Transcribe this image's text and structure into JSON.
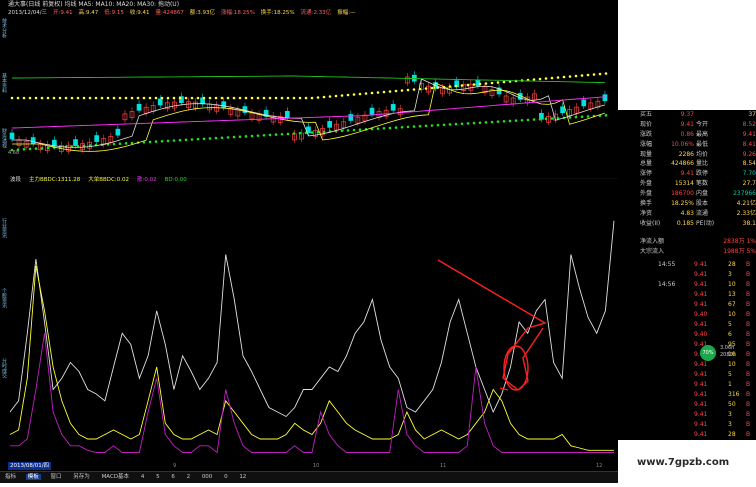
{
  "title_bar": "通大事(日线 前复权) 均线 MA5: MA10: MA20: MA30: 拖动(U)",
  "info_bar": [
    "2013/12/04/三",
    "开:9.41",
    "高:9.47",
    "低:9.15",
    "收:9.41",
    "量:424867",
    "额:3.93亿",
    "涨幅:18.25%",
    "换手:18.25%",
    "流通:2.33亿",
    "振幅:—"
  ],
  "indicator_header": [
    "波段",
    "主力BBDC:1311.28",
    "大单BBDC:0.02",
    "散:0.02",
    "BD:0.00"
  ],
  "chart_labels": {
    "bottom_price": "4.68",
    "date_box": "2013/08/01/四"
  },
  "x_axis_labels": [
    "9",
    "10",
    "11",
    "12"
  ],
  "bottom_tabs": [
    "指标",
    "模板",
    "窗口",
    "另存为",
    "MACD基本",
    "4",
    "5",
    "6",
    "2",
    "000",
    "0",
    "12"
  ],
  "stats_rows": [
    {
      "l1": "买五",
      "v1": "9.37",
      "l2": "",
      "v2": "37"
    },
    {
      "l1": "现价",
      "v1": "9.41",
      "l2": "今开",
      "v2": "8.52"
    },
    {
      "l1": "涨跌",
      "v1": "0.86",
      "l2": "最高",
      "v2": "9.41"
    },
    {
      "l1": "涨幅",
      "v1": "10.06%",
      "l2": "最低",
      "v2": "8.41"
    },
    {
      "l1": "现量",
      "v1": "2286",
      "l2": "均价",
      "v2": "9.26"
    },
    {
      "l1": "总量",
      "v1": "424866",
      "l2": "量比",
      "v2": "8.54"
    },
    {
      "l1": "涨停",
      "v1": "9.41",
      "l2": "跌停",
      "v2": "7.70"
    },
    {
      "l1": "外盘",
      "v1": "15314",
      "l2": "笔数",
      "v2": "27.7"
    },
    {
      "l1": "外盘",
      "v1": "186700",
      "l2": "内盘",
      "v2": "237966"
    },
    {
      "l1": "换手",
      "v1": "18.25%",
      "l2": "股本",
      "v2": "4.21亿"
    },
    {
      "l1": "净资",
      "v1": "4.83",
      "l2": "流通",
      "v2": "2.33亿"
    },
    {
      "l1": "收益(II)",
      "v1": "0.185",
      "l2": "PE(动)",
      "v2": "38.1"
    }
  ],
  "flow_rows": [
    {
      "label": "净流入额",
      "value": "2838万 1%"
    },
    {
      "label": "大宗流入",
      "value": "1988万 5%"
    }
  ],
  "tick_rows": [
    {
      "time": "14:55",
      "price": "9.41",
      "vol": "28",
      "dir": "B"
    },
    {
      "time": "",
      "price": "9.41",
      "vol": "3",
      "dir": "B"
    },
    {
      "time": "14:56",
      "price": "9.41",
      "vol": "10",
      "dir": "B"
    },
    {
      "time": "",
      "price": "9.41",
      "vol": "13",
      "dir": "B"
    },
    {
      "time": "",
      "price": "9.41",
      "vol": "67",
      "dir": "B"
    },
    {
      "time": "",
      "price": "9.40",
      "vol": "10",
      "dir": "B"
    },
    {
      "time": "",
      "price": "9.41",
      "vol": "5",
      "dir": "B"
    },
    {
      "time": "",
      "price": "9.40",
      "vol": "6",
      "dir": "B"
    },
    {
      "time": "",
      "price": "9.41",
      "vol": "95",
      "dir": "B"
    },
    {
      "time": "",
      "price": "9.41",
      "vol": "10",
      "dir": "B"
    },
    {
      "time": "",
      "price": "9.41",
      "vol": "10",
      "dir": "B"
    },
    {
      "time": "",
      "price": "9.41",
      "vol": "5",
      "dir": "B"
    },
    {
      "time": "",
      "price": "9.41",
      "vol": "1",
      "dir": "B"
    },
    {
      "time": "",
      "price": "9.41",
      "vol": "316",
      "dir": "B"
    },
    {
      "time": "",
      "price": "9.41",
      "vol": "50",
      "dir": "B"
    },
    {
      "time": "",
      "price": "9.41",
      "vol": "3",
      "dir": "B"
    },
    {
      "time": "",
      "price": "9.41",
      "vol": "3",
      "dir": "B"
    },
    {
      "time": "",
      "price": "9.41",
      "vol": "28",
      "dir": "B"
    }
  ],
  "gauge": {
    "label": "70%",
    "v1": "3.06h",
    "v2": "2080h"
  },
  "watermark": "www.7gpzb.com",
  "colors": {
    "bg": "#000000",
    "up": "#ff4444",
    "down": "#00e0e0",
    "yellow": "#ffff30",
    "magenta": "#ff30ff",
    "green": "#20e020",
    "white": "#e0e0e0",
    "purple": "#c020c0",
    "annotation": "#ff2020"
  },
  "chart_data": {
    "type": "line",
    "series": [
      {
        "values": [
          0.2,
          0.25,
          0.55,
          0.88,
          0.6,
          0.3,
          0.35,
          0.42,
          0.38,
          0.3,
          0.28,
          0.25,
          0.4,
          0.55,
          0.5,
          0.35,
          0.45,
          0.65,
          0.5,
          0.3,
          0.45,
          0.38,
          0.3,
          0.35,
          0.42,
          0.9,
          0.7,
          0.45,
          0.38,
          0.3,
          0.22,
          0.2,
          0.18,
          0.22,
          0.3,
          0.3,
          0.35,
          0.4,
          0.38,
          0.45,
          0.55,
          0.6,
          0.7,
          0.52,
          0.4,
          0.35,
          0.22,
          0.2,
          0.25,
          0.3,
          0.42,
          0.6,
          0.7,
          0.55,
          0.4,
          0.3,
          0.2,
          0.28,
          0.4,
          0.6,
          0.55,
          0.65,
          0.7,
          0.42,
          0.35,
          0.9,
          0.75,
          0.62,
          0.55,
          0.65,
          1.05
        ]
      },
      {
        "values": [
          0.1,
          0.12,
          0.35,
          0.85,
          0.65,
          0.4,
          0.25,
          0.15,
          0.1,
          0.08,
          0.08,
          0.1,
          0.12,
          0.1,
          0.08,
          0.1,
          0.25,
          0.4,
          0.15,
          0.1,
          0.08,
          0.08,
          0.1,
          0.12,
          0.1,
          0.25,
          0.2,
          0.15,
          0.1,
          0.08,
          0.08,
          0.08,
          0.1,
          0.15,
          0.12,
          0.1,
          0.15,
          0.25,
          0.2,
          0.15,
          0.12,
          0.1,
          0.08,
          0.08,
          0.08,
          0.1,
          0.2,
          0.12,
          0.08,
          0.1,
          0.12,
          0.1,
          0.08,
          0.1,
          0.15,
          0.2,
          0.3,
          0.25,
          0.15,
          0.1,
          0.08,
          0.08,
          0.08,
          0.08,
          0.1,
          0.05,
          0.04,
          0.03,
          0.03,
          0.03,
          0.03
        ]
      },
      {
        "values": [
          0.05,
          0.05,
          0.08,
          0.3,
          0.55,
          0.2,
          0.1,
          0.05,
          0.05,
          0.03,
          0.02,
          0.02,
          0.05,
          0.02,
          0.02,
          0.02,
          0.2,
          0.35,
          0.1,
          0.05,
          0.02,
          0.02,
          0.05,
          0.05,
          0.02,
          0.3,
          0.15,
          0.05,
          0.02,
          0.02,
          0.02,
          0.02,
          0.02,
          0.05,
          0.02,
          0.02,
          0.2,
          0.1,
          0.05,
          0.02,
          0.02,
          0.02,
          0.02,
          0.02,
          0.02,
          0.3,
          0.1,
          0.05,
          0.02,
          0.02,
          0.02,
          0.02,
          0.02,
          0.05,
          0.4,
          0.15,
          0.05,
          0.02,
          0.02,
          0.02,
          0.02,
          0.02,
          0.02,
          0.02,
          0.02,
          0.02,
          0.02,
          0.02,
          0.02,
          0.02,
          0.02
        ]
      }
    ]
  }
}
